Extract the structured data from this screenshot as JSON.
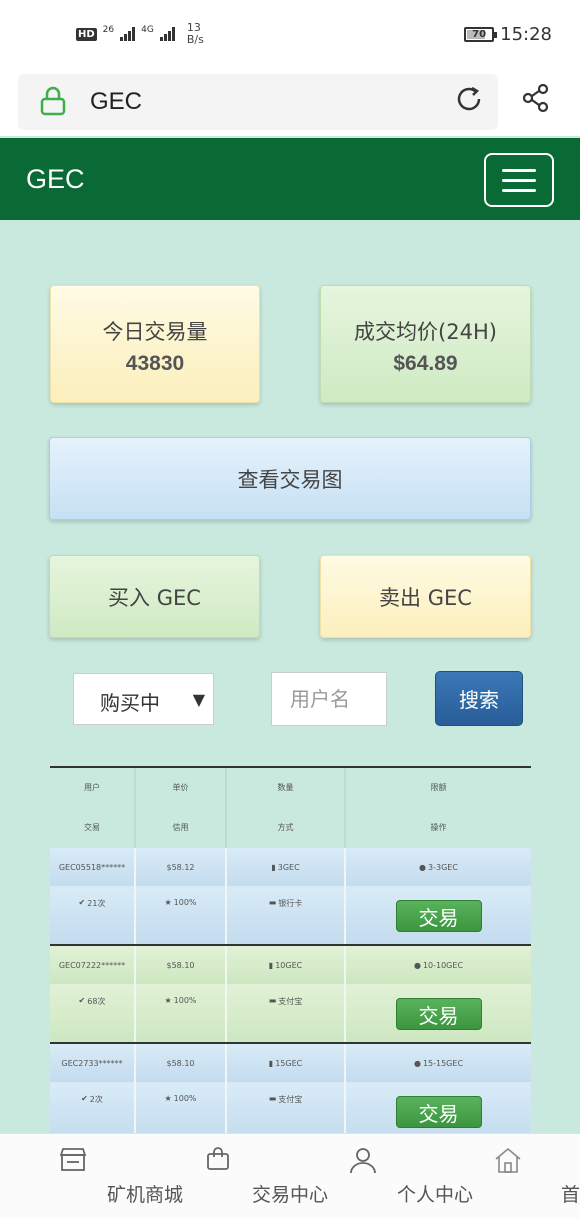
{
  "status_bar": {
    "hd": "HD",
    "net_26": "26",
    "net_4g": "4G",
    "speed_value": "13",
    "speed_unit": "B/s",
    "battery": "70",
    "time": "15:28"
  },
  "browser": {
    "url": "GEC"
  },
  "navbar": {
    "brand": "GEC"
  },
  "stats": {
    "volume_label": "今日交易量",
    "volume_value": "43830",
    "avg_label": "成交均价(24H)",
    "avg_value": "$64.89"
  },
  "actions": {
    "chart": "查看交易图",
    "buy": "买入 GEC",
    "sell": "卖出 GEC"
  },
  "filter": {
    "select_value": "购买中",
    "user_placeholder": "用户名",
    "search": "搜索"
  },
  "table": {
    "headers_top": [
      "用户",
      "单价",
      "数量",
      "限额"
    ],
    "headers_bottom": [
      "交易",
      "信用",
      "方式",
      "操作"
    ],
    "rows": [
      {
        "user": "GEC05518******",
        "price": "$58.12",
        "qty": "3GEC",
        "limit": "3-3GEC",
        "trades": "21次",
        "credit": "100%",
        "method": "银行卡",
        "action": "交易"
      },
      {
        "user": "GEC07222******",
        "price": "$58.10",
        "qty": "10GEC",
        "limit": "10-10GEC",
        "trades": "68次",
        "credit": "100%",
        "method": "支付宝",
        "action": "交易"
      },
      {
        "user": "GEC2733******",
        "price": "$58.10",
        "qty": "15GEC",
        "limit": "15-15GEC",
        "trades": "2次",
        "credit": "100%",
        "method": "支付宝",
        "action": "交易"
      }
    ]
  },
  "bottom_nav": {
    "items": [
      "矿机商城",
      "交易中心",
      "个人中心",
      "首页"
    ]
  }
}
